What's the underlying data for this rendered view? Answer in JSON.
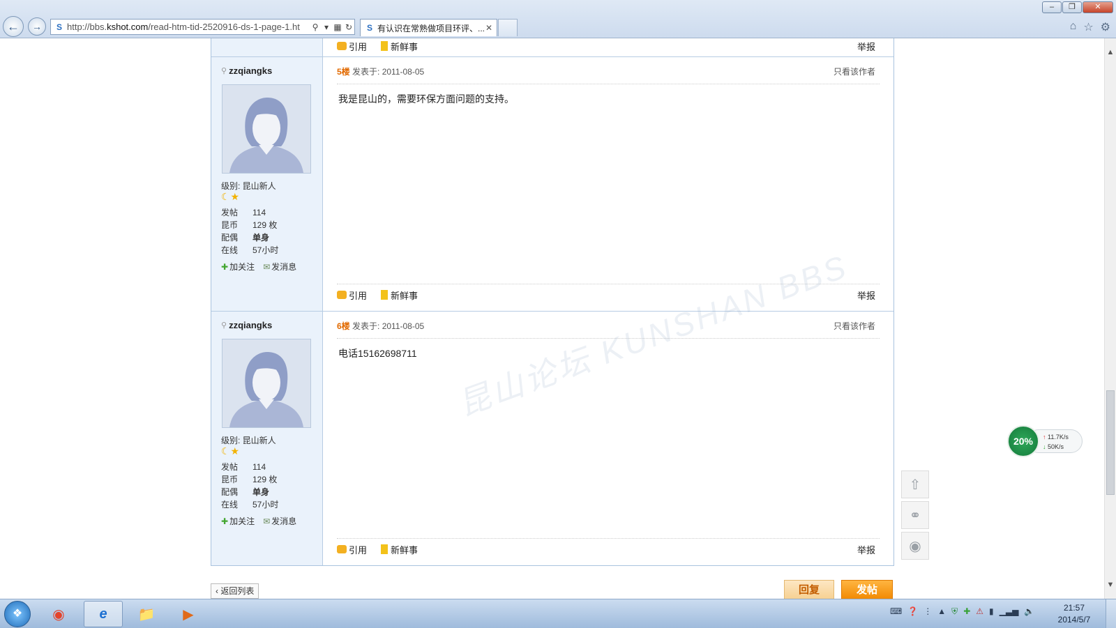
{
  "browser": {
    "url_prefix": "http://bbs.",
    "url_domain": "kshot.com",
    "url_suffix": "/read-htm-tid-2520916-ds-1-page-1.ht",
    "tab_title": "有认识在常熟做项目环评、...",
    "window_buttons": [
      "–",
      "❐",
      "✕"
    ]
  },
  "top_partial": {
    "quote_label": "引用",
    "news_label": "新鲜事",
    "report_label": "举报"
  },
  "posts": [
    {
      "username": "zzqiangks",
      "level_label": "级别: 昆山新人",
      "stats": [
        {
          "k": "发帖",
          "v": "114"
        },
        {
          "k": "昆币",
          "v": "129 枚"
        },
        {
          "k": "配偶",
          "v": "单身"
        },
        {
          "k": "在线",
          "v": "57小时"
        }
      ],
      "follow_label": "加关注",
      "message_label": "发消息",
      "floor": "5楼",
      "posted": "发表于: 2011-08-05",
      "only_author": "只看该作者",
      "content": "我是昆山的，需要环保方面问题的支持。",
      "quote_label": "引用",
      "news_label": "新鲜事",
      "report_label": "举报"
    },
    {
      "username": "zzqiangks",
      "level_label": "级别: 昆山新人",
      "stats": [
        {
          "k": "发帖",
          "v": "114"
        },
        {
          "k": "昆币",
          "v": "129 枚"
        },
        {
          "k": "配偶",
          "v": "单身"
        },
        {
          "k": "在线",
          "v": "57小时"
        }
      ],
      "follow_label": "加关注",
      "message_label": "发消息",
      "floor": "6楼",
      "posted": "发表于: 2011-08-05",
      "only_author": "只看该作者",
      "content": "电话15162698711",
      "quote_label": "引用",
      "news_label": "新鲜事",
      "report_label": "举报"
    }
  ],
  "bottom": {
    "back_list": "返回列表",
    "reply": "回复",
    "post": "发帖"
  },
  "net_widget": {
    "percent": "20%",
    "up": "11.7K/s",
    "down": "50K/s"
  },
  "taskbar": {
    "time": "21:57",
    "date": "2014/5/7"
  },
  "watermark": "昆山论坛 KUNSHAN BBS"
}
